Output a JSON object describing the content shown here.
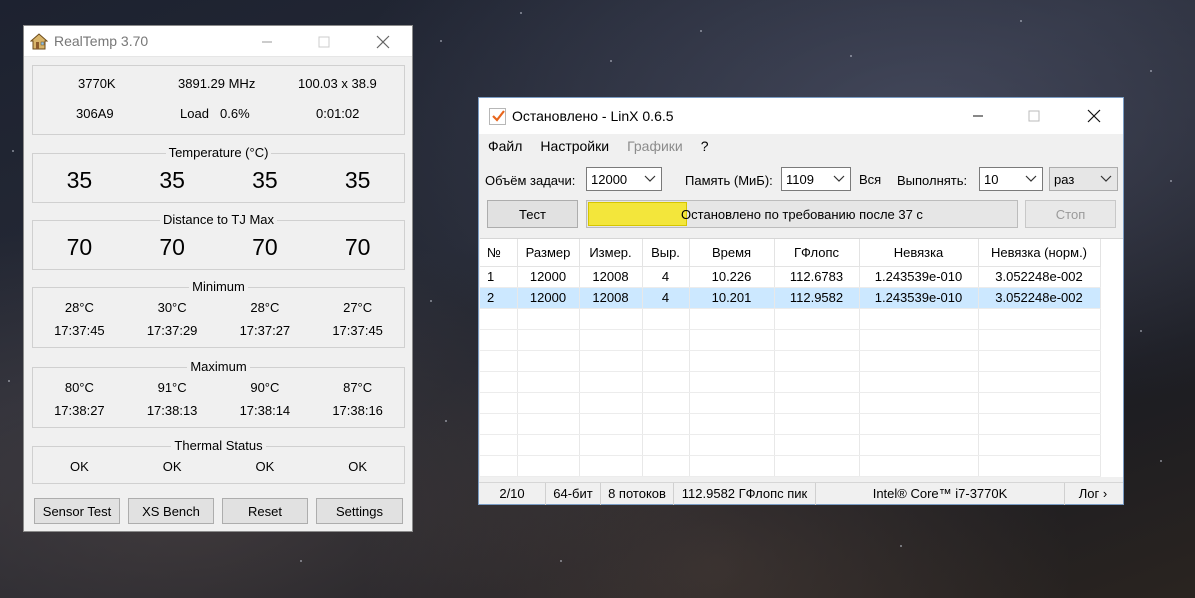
{
  "realtemp": {
    "title": "RealTemp 3.70",
    "cpu_model": "3770K",
    "frequency": "3891.29 MHz",
    "multiplier": "100.03 x 38.9",
    "cpuid": "306A9",
    "load_label": "Load",
    "load_value": "0.6%",
    "uptime": "0:01:02",
    "temperature_title": "Temperature (°C)",
    "temperatures": [
      "35",
      "35",
      "35",
      "35"
    ],
    "distance_title": "Distance to TJ Max",
    "distances": [
      "70",
      "70",
      "70",
      "70"
    ],
    "minimum_title": "Minimum",
    "minimum": [
      {
        "temp": "28°C",
        "time": "17:37:45"
      },
      {
        "temp": "30°C",
        "time": "17:37:29"
      },
      {
        "temp": "28°C",
        "time": "17:37:27"
      },
      {
        "temp": "27°C",
        "time": "17:37:45"
      }
    ],
    "maximum_title": "Maximum",
    "maximum": [
      {
        "temp": "80°C",
        "time": "17:38:27"
      },
      {
        "temp": "91°C",
        "time": "17:38:13"
      },
      {
        "temp": "90°C",
        "time": "17:38:14"
      },
      {
        "temp": "87°C",
        "time": "17:38:16"
      }
    ],
    "thermal_title": "Thermal Status",
    "thermal": [
      "OK",
      "OK",
      "OK",
      "OK"
    ],
    "buttons": {
      "sensor_test": "Sensor Test",
      "xs_bench": "XS Bench",
      "reset": "Reset",
      "settings": "Settings"
    }
  },
  "linx": {
    "title": "Остановлено - LinX 0.6.5",
    "menu": [
      "Файл",
      "Настройки",
      "Графики",
      "?"
    ],
    "task_size_label": "Объём задачи:",
    "task_size_value": "12000",
    "memory_label": "Память (МиБ):",
    "memory_value": "1109",
    "all_label": "Вся",
    "run_label": "Выполнять:",
    "run_count": "10",
    "run_unit": "раз",
    "test_button": "Тест",
    "stop_button": "Стоп",
    "progress_text": "Остановлено по требованию после 37 с",
    "progress_fraction": 0.23,
    "table": {
      "headers": [
        "№",
        "Размер",
        "Измер.",
        "Выр.",
        "Время",
        "ГФлопс",
        "Невязка",
        "Невязка (норм.)"
      ],
      "rows": [
        [
          "1",
          "12000",
          "12008",
          "4",
          "10.226",
          "112.6783",
          "1.243539e-010",
          "3.052248e-002"
        ],
        [
          "2",
          "12000",
          "12008",
          "4",
          "10.201",
          "112.9582",
          "1.243539e-010",
          "3.052248e-002"
        ]
      ]
    },
    "status": {
      "runs": "2/10",
      "bits": "64-бит",
      "threads": "8 потоков",
      "peak": "112.9582 ГФлопс пик",
      "cpu": "Intel® Core™ i7-3770K",
      "log": "Лог ›"
    }
  },
  "colors": {
    "progress_fill": "#f3e63b",
    "selected_row": "#cce8ff",
    "check_mark": "#e8661d"
  }
}
